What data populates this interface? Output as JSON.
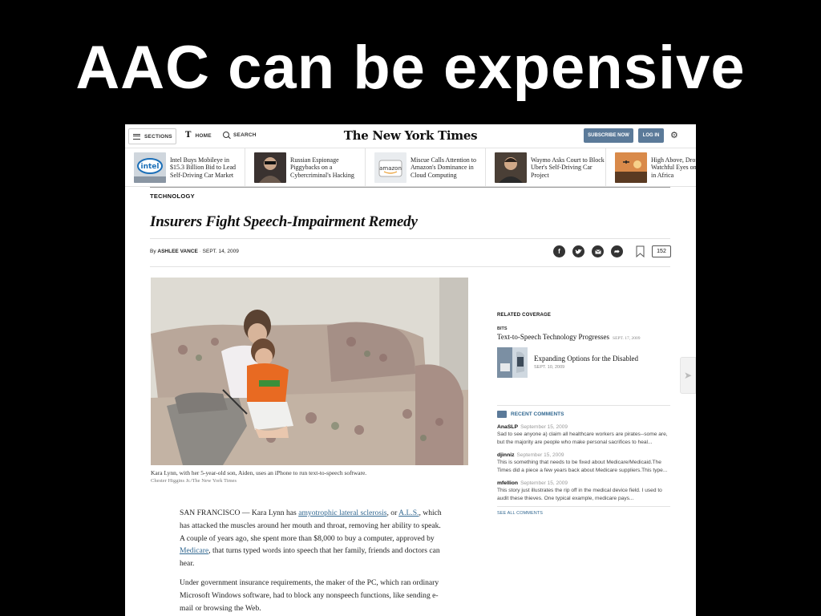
{
  "slide": {
    "title": "AAC can be expensive"
  },
  "nav": {
    "sections": "SECTIONS",
    "home": "HOME",
    "search": "SEARCH",
    "masthead": "The New York Times",
    "subscribe": "SUBSCRIBE NOW",
    "login": "LOG IN"
  },
  "promos": [
    {
      "text": "Intel Buys Mobileye in $15.3 Billion Bid to Lead Self-Driving Car Market"
    },
    {
      "text": "Russian Espionage Piggybacks on a Cybercriminal's Hacking"
    },
    {
      "text": "Miscue Calls Attention to Amazon's Dominance in Cloud Computing"
    },
    {
      "text": "Waymo Asks Court to Block Uber's Self-Driving Car Project"
    },
    {
      "text": "High Above, Drones Keep Watchful Eyes on Wildlife in Africa"
    }
  ],
  "article": {
    "kicker": "TECHNOLOGY",
    "headline": "Insurers Fight Speech-Impairment Remedy",
    "byline_prefix": "By",
    "author": "ASHLEE VANCE",
    "date": "SEPT. 14, 2009",
    "comment_count": "152",
    "caption": "Kara Lynn, with her 5-year-old son, Aiden, uses an iPhone to run text-to-speech software.",
    "credit": "Chester Higgins Jr./The New York Times",
    "p1": {
      "a": "SAN FRANCISCO — Kara Lynn has ",
      "link1": "amyotrophic lateral sclerosis",
      "b": ", or ",
      "link2": "A.L.S.",
      "c": ", which has attacked the muscles around her mouth and throat, removing her ability to speak. A couple of years ago, she spent more than $8,000 to buy a computer, approved by ",
      "link3": "Medicare",
      "d": ", that turns typed words into speech that her family, friends and doctors can hear."
    },
    "p2": "Under government insurance requirements, the maker of the PC, which ran ordinary Microsoft Windows software, had to block any nonspeech functions, like sending e-mail or browsing the Web."
  },
  "sidebar": {
    "related_heading": "RELATED COVERAGE",
    "bits_label": "BITS",
    "related1_title": "Text-to-Speech Technology Progresses",
    "related1_date": "SEPT. 17, 2009",
    "related2_title": "Expanding Options for the Disabled",
    "related2_date": "SEPT. 10, 2009",
    "comments_heading": "RECENT COMMENTS",
    "comments": [
      {
        "user": "AnaSLP",
        "date": "September 15, 2009",
        "text": "Sad to see anyone a) claim all healthcare workers are pirates--some are, but the majority are people who make personal sacrifices to heal..."
      },
      {
        "user": "djinniz",
        "date": "September 15, 2009",
        "text": "This is something that needs to be fixed about Medicare/Medicaid.The Times did a piece a few years back about Medicare suppliers.This type..."
      },
      {
        "user": "mfellion",
        "date": "September 15, 2009",
        "text": "This story just illustrates the rip off in the medical device field. I used to audit these thieves. One typical example, medicare pays..."
      }
    ],
    "see_all": "SEE ALL COMMENTS"
  }
}
